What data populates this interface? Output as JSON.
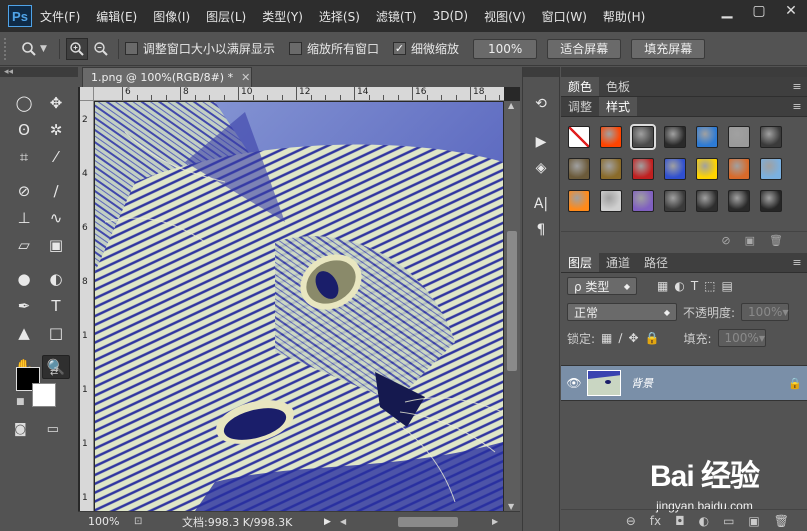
{
  "app": {
    "logo": "Ps"
  },
  "menubar": {
    "items": [
      "文件(F)",
      "编辑(E)",
      "图像(I)",
      "图层(L)",
      "类型(Y)",
      "选择(S)",
      "滤镜(T)",
      "3D(D)",
      "视图(V)",
      "窗口(W)",
      "帮助(H)"
    ],
    "window_buttons": [
      "minimize-icon",
      "maximize-icon",
      "close-icon"
    ]
  },
  "options_bar": {
    "tool_icon": "zoom-icon",
    "zoom_in_icon": "zoom-in-icon",
    "zoom_out_icon": "zoom-out-icon",
    "checkboxes": [
      {
        "label": "调整窗口大小以满屏显示",
        "checked": false
      },
      {
        "label": "缩放所有窗口",
        "checked": false
      },
      {
        "label": "细微缩放",
        "checked": true
      }
    ],
    "buttons": [
      "100%",
      "适合屏幕",
      "填充屏幕"
    ]
  },
  "toolbox": {
    "tools": [
      {
        "name": "marquee-icon",
        "glyph": "◯"
      },
      {
        "name": "move-icon",
        "glyph": "✥"
      },
      {
        "name": "lasso-icon",
        "glyph": "ʘ"
      },
      {
        "name": "magic-wand-icon",
        "glyph": "✲"
      },
      {
        "name": "crop-icon",
        "glyph": "⌗"
      },
      {
        "name": "eyedropper-icon",
        "glyph": "⁄"
      },
      {
        "name": "healing-brush-icon",
        "glyph": "⊘"
      },
      {
        "name": "brush-icon",
        "glyph": "∕"
      },
      {
        "name": "clone-stamp-icon",
        "glyph": "⊥"
      },
      {
        "name": "history-brush-icon",
        "glyph": "∿"
      },
      {
        "name": "eraser-icon",
        "glyph": "▱"
      },
      {
        "name": "gradient-icon",
        "glyph": "▣"
      },
      {
        "name": "blur-icon",
        "glyph": "●"
      },
      {
        "name": "dodge-icon",
        "glyph": "◐"
      },
      {
        "name": "pen-icon",
        "glyph": "✒"
      },
      {
        "name": "type-icon",
        "glyph": "T"
      },
      {
        "name": "path-selection-icon",
        "glyph": "▲"
      },
      {
        "name": "rectangle-icon",
        "glyph": "□"
      },
      {
        "name": "hand-icon",
        "glyph": "✋"
      },
      {
        "name": "zoom-tool-icon",
        "glyph": "🔍"
      }
    ],
    "colors": {
      "foreground": "#000000",
      "background": "#ffffff"
    }
  },
  "document": {
    "tab_title": "1.png @ 100%(RGB/8#) *",
    "ruler_top_labels": [
      "6",
      "8",
      "10",
      "12",
      "14",
      "16",
      "18"
    ],
    "ruler_left_labels": [
      "2",
      "4",
      "6",
      "8",
      "1",
      "1",
      "1",
      "1"
    ],
    "status_zoom": "100%",
    "status_doc": "文档:998.3 K/998.3K"
  },
  "side_strip": [
    "history-icon",
    "play-icon",
    "3d-icon",
    "character-icon",
    "paragraph-icon"
  ],
  "color_panel": {
    "tabs": [
      "颜色",
      "色板"
    ]
  },
  "styles_panel": {
    "tabs": [
      "调整",
      "样式"
    ],
    "swatches": [
      "#ffffff",
      "#ff4400",
      "#4a4a4a",
      "#2a2a2a",
      "#2e7bd4",
      "#9a9a9a",
      "#3a3a3a",
      "#6b5a3a",
      "#8a6b2a",
      "#c02020",
      "#3050d0",
      "#ffd400",
      "#d86a2a",
      "#7ab0e0",
      "#ff8a1a",
      "#cfcfcf",
      "#8060c0",
      "#3a3a3a",
      "#2e2e2e",
      "#2a2a2a",
      "#262626"
    ]
  },
  "layers_panel": {
    "tabs": [
      "图层",
      "通道",
      "路径"
    ],
    "kind_filter": "ρ 类型",
    "blend_mode": "正常",
    "opacity_label": "不透明度:",
    "opacity_value": "100%",
    "lock_label": "锁定:",
    "fill_label": "填充:",
    "fill_value": "100%",
    "layer_name": "背景"
  },
  "watermark": {
    "main": "Bai 经验",
    "sub": "jingyan.baidu.com"
  }
}
